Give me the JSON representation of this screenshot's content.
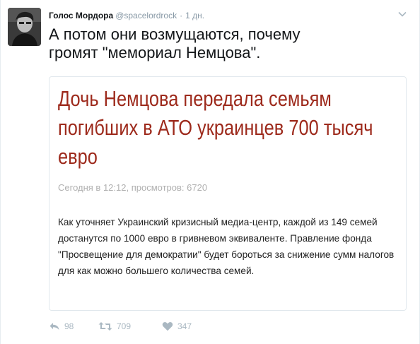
{
  "author": {
    "name": "Голос Мордора",
    "handle": "@spacelordrock",
    "separator": "·",
    "timestamp": "1 дн."
  },
  "tweet": {
    "text": "А потом они возмущаются, почему громят \"мемориал Немцова\"."
  },
  "card": {
    "headline": "Дочь Немцова передала семьям погибших в АТО украинцев 700 тысяч евро",
    "meta": "Сегодня в 12:12, просмотров: 6720",
    "body": "Как уточняет Украинский кризисный медиа-центр, каждой из 149 семей достанутся по 1000 евро в гривневом эквиваленте. Правление фонда \"Просвещение для демократии\" будет бороться за снижение сумм налогов для как можно большего количества семей."
  },
  "actions": {
    "reply": {
      "icon": "reply-icon",
      "count": "98"
    },
    "retweet": {
      "icon": "retweet-icon",
      "count": "709"
    },
    "like": {
      "icon": "heart-icon",
      "count": "347"
    }
  },
  "colors": {
    "headline": "#9d2a1c",
    "action_gray": "#aab8c2",
    "meta_gray": "#8899a6"
  }
}
